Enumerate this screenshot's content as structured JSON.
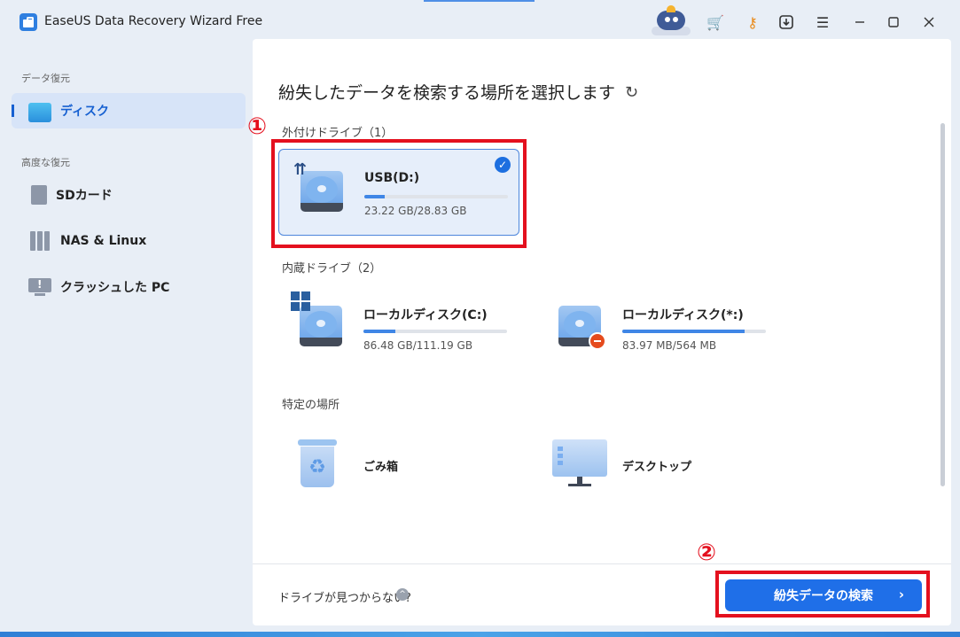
{
  "app": {
    "title": "EaseUS Data Recovery Wizard Free"
  },
  "titlebar": {
    "icons": [
      "robot-assistant-icon",
      "cart-icon",
      "key-icon",
      "download-icon",
      "menu-icon",
      "minimize-icon",
      "maximize-icon",
      "close-icon"
    ]
  },
  "sidebar": {
    "section_data_recovery": "データ復元",
    "section_advanced": "高度な復元",
    "items": [
      {
        "label": "ディスク",
        "icon": "disk-icon",
        "active": true
      },
      {
        "label": "SDカード",
        "icon": "sd-card-icon",
        "active": false
      },
      {
        "label": "NAS & Linux",
        "icon": "nas-icon",
        "active": false
      },
      {
        "label": "クラッシュした PC",
        "icon": "crashed-pc-icon",
        "active": false
      }
    ]
  },
  "main": {
    "title": "紛失したデータを検索する場所を選択します",
    "external_label": "外付けドライブ（1）",
    "internal_label": "内蔵ドライブ（2）",
    "specific_label": "特定の場所",
    "external_drives": [
      {
        "name": "USB(D:)",
        "size": "23.22 GB/28.83 GB",
        "used_fraction": 0.14,
        "selected": true
      }
    ],
    "internal_drives": [
      {
        "name": "ローカルディスク(C:)",
        "size": "86.48 GB/111.19 GB",
        "used_fraction": 0.22
      },
      {
        "name": "ローカルディスク(*:)",
        "size": "83.97 MB/564 MB",
        "used_fraction": 0.85
      }
    ],
    "places": [
      {
        "name": "ごみ箱",
        "icon": "recycle-bin-icon"
      },
      {
        "name": "デスクトップ",
        "icon": "desktop-icon"
      }
    ]
  },
  "annotations": {
    "step1": "①",
    "step2": "②",
    "color": "#e4101e"
  },
  "footer": {
    "not_found": "ドライブが見つからない?",
    "scan_button": "紛失データの検索",
    "help_glyph": "^",
    "chevron": "›"
  },
  "colors": {
    "accent": "#1f6fe8",
    "selected_bg": "#e6eefa",
    "sidebar_bg": "#e8eef6"
  }
}
